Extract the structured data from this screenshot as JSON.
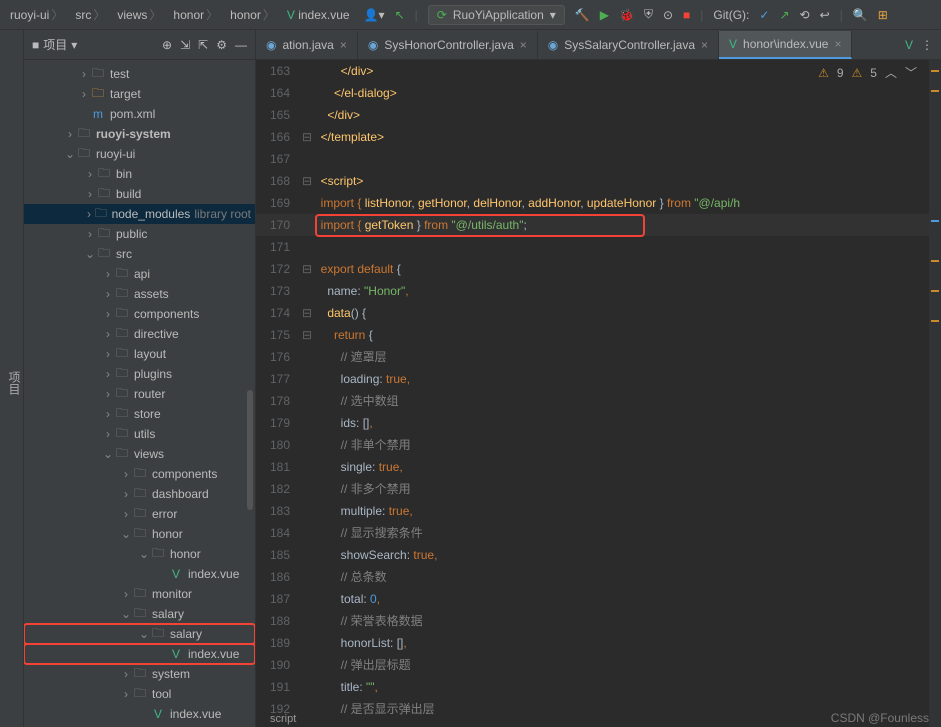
{
  "breadcrumb": [
    "ruoyi-ui",
    "src",
    "views",
    "honor",
    "honor",
    "index.vue"
  ],
  "runConfig": "RuoYiApplication",
  "gitLabel": "Git(G):",
  "sidebar": {
    "title": "项目",
    "tree": {
      "test": "test",
      "target": "target",
      "pom": "pom.xml",
      "ruoyi_system": "ruoyi-system",
      "ruoyi_ui": "ruoyi-ui",
      "bin": "bin",
      "build": "build",
      "node_modules": "node_modules",
      "node_hint": "library root",
      "public": "public",
      "src": "src",
      "api": "api",
      "assets": "assets",
      "components": "components",
      "directive": "directive",
      "layout": "layout",
      "plugins": "plugins",
      "router": "router",
      "store": "store",
      "utils": "utils",
      "views": "views",
      "v_components": "components",
      "dashboard": "dashboard",
      "error": "error",
      "honor": "honor",
      "honor2": "honor",
      "index_vue": "index.vue",
      "monitor": "monitor",
      "salary": "salary",
      "salary2": "salary",
      "s_index": "index.vue",
      "system": "system",
      "tool": "tool",
      "v_index": "index.vue"
    }
  },
  "tabs": [
    {
      "label": "ation.java",
      "type": "java",
      "active": false,
      "close": true
    },
    {
      "label": "SysHonorController.java",
      "type": "java",
      "active": false,
      "close": true
    },
    {
      "label": "SysSalaryController.java",
      "type": "java",
      "active": false,
      "close": true
    },
    {
      "label": "honor\\index.vue",
      "type": "vue",
      "active": true,
      "close": true
    }
  ],
  "warnings": {
    "w": "9",
    "e": "5"
  },
  "lines_start": 163,
  "code": {
    "l163": "        </div>",
    "l164": "      </el-dialog>",
    "l165": "    </div>",
    "l166": "  </template>",
    "l167": "",
    "l168": "  <script>",
    "l169a": "  import { ",
    "l169b": "listHonor",
    "l169c": ", ",
    "l169d": "getHonor",
    "l169e": ", ",
    "l169f": "delHonor",
    "l169g": ", ",
    "l169h": "addHonor",
    "l169i": ", ",
    "l169j": "updateHonor",
    "l169k": " } ",
    "l169l": "from ",
    "l169m": "\"@/api/h",
    "l170a": "  import { ",
    "l170b": "getToken",
    "l170c": " } ",
    "l170d": "from ",
    "l170e": "\"@/utils/auth\"",
    "l171": "",
    "l172a": "  export ",
    "l172b": "default ",
    "l172c": "{",
    "l173a": "    name: ",
    "l173b": "\"Honor\"",
    "l173c": ",",
    "l174a": "    data",
    "l174b": "() {",
    "l175a": "      return ",
    "l175b": "{",
    "l176": "        // 遮罩层",
    "l177a": "        loading: ",
    "l177b": "true",
    "l177c": ",",
    "l178": "        // 选中数组",
    "l179a": "        ids: ",
    "l179b": "[]",
    "l179c": ",",
    "l180": "        // 非单个禁用",
    "l181a": "        single: ",
    "l181b": "true",
    "l181c": ",",
    "l182": "        // 非多个禁用",
    "l183a": "        multiple: ",
    "l183b": "true",
    "l183c": ",",
    "l184": "        // 显示搜索条件",
    "l185a": "        showSearch: ",
    "l185b": "true",
    "l185c": ",",
    "l186": "        // 总条数",
    "l187a": "        total: ",
    "l187b": "0",
    "l187c": ",",
    "l188": "        // 荣誉表格数据",
    "l189a": "        honorList: ",
    "l189b": "[]",
    "l189c": ",",
    "l190": "        // 弹出层标题",
    "l191a": "        title: ",
    "l191b": "\"\"",
    "l191c": ",",
    "l192": "        // 是否显示弹出层"
  },
  "bottom": "script",
  "watermark": "CSDN @Founless"
}
